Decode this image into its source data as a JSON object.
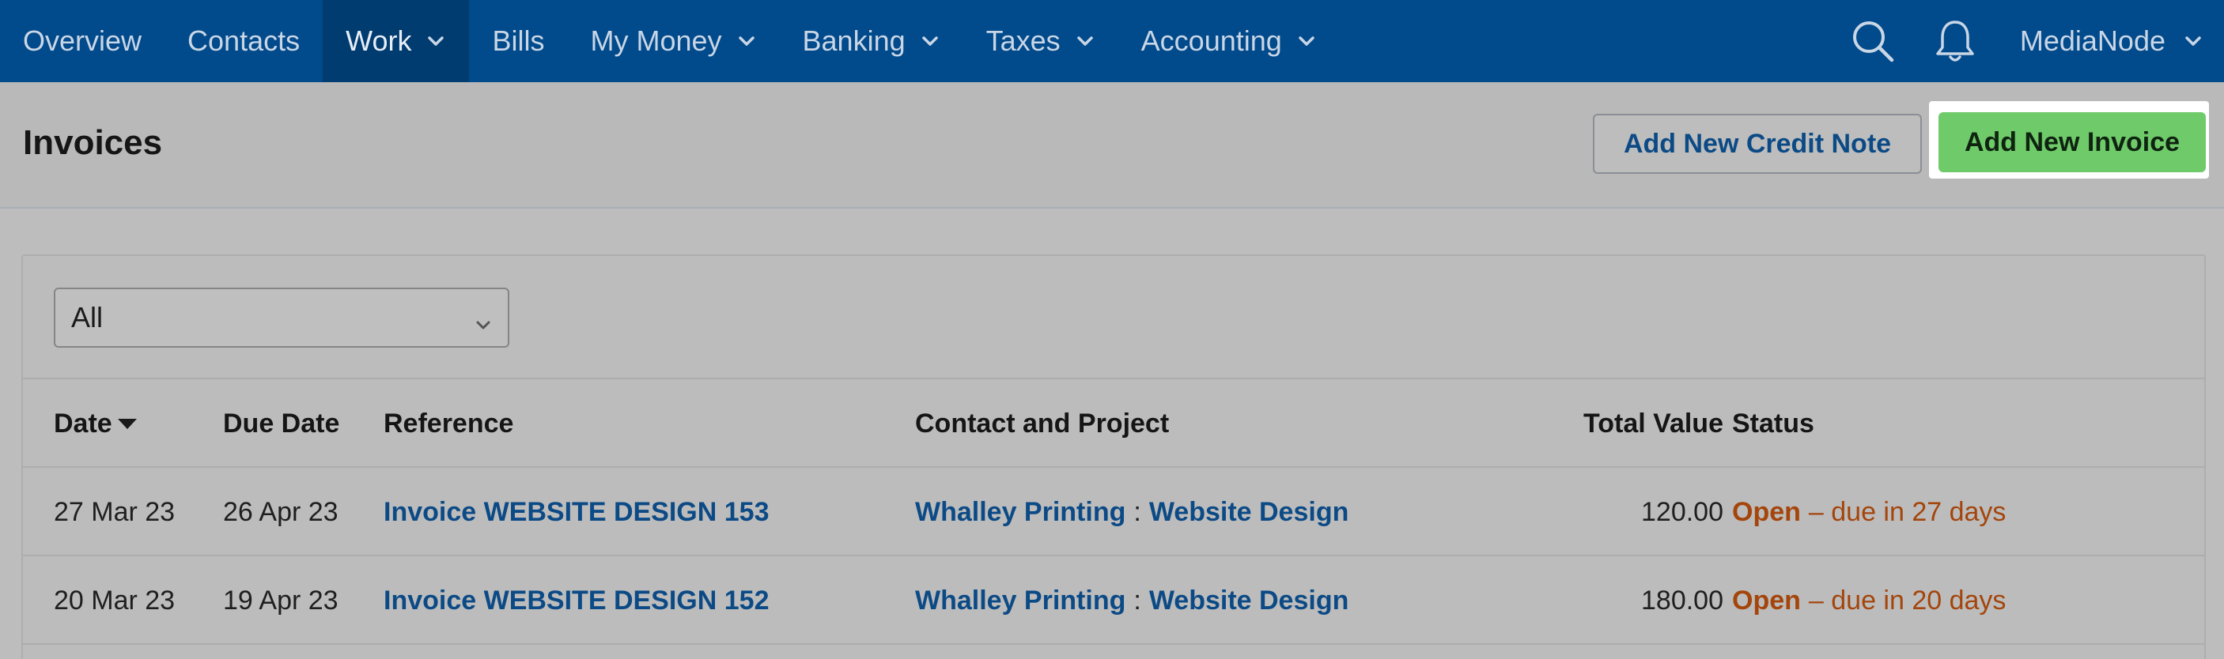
{
  "nav": {
    "items": [
      {
        "label": "Overview"
      },
      {
        "label": "Contacts"
      },
      {
        "label": "Work"
      },
      {
        "label": "Bills"
      },
      {
        "label": "My Money"
      },
      {
        "label": "Banking"
      },
      {
        "label": "Taxes"
      },
      {
        "label": "Accounting"
      }
    ],
    "active": "Work",
    "user": "MediaNode"
  },
  "page": {
    "title": "Invoices",
    "credit_note_button": "Add New Credit Note",
    "new_invoice_button": "Add New Invoice"
  },
  "filter": {
    "selected": "All"
  },
  "table": {
    "headers": {
      "date": "Date",
      "due_date": "Due Date",
      "reference": "Reference",
      "contact": "Contact and Project",
      "total": "Total Value",
      "status": "Status"
    },
    "rows": [
      {
        "date": "27 Mar 23",
        "due_date": "26 Apr 23",
        "reference": "Invoice WEBSITE DESIGN 153",
        "contact": "Whalley Printing",
        "separator": ":",
        "project": "Website Design",
        "total": "120.00",
        "status": "Open",
        "status_detail": "– due in 27 days"
      },
      {
        "date": "20 Mar 23",
        "due_date": "19 Apr 23",
        "reference": "Invoice WEBSITE DESIGN 152",
        "contact": "Whalley Printing",
        "separator": ":",
        "project": "Website Design",
        "total": "180.00",
        "status": "Open",
        "status_detail": "– due in 20 days"
      }
    ]
  },
  "colors": {
    "nav_bg": "#014a8b",
    "link": "#0c4a86",
    "primary_button": "#6fca6a",
    "status_open": "#a4450c"
  }
}
